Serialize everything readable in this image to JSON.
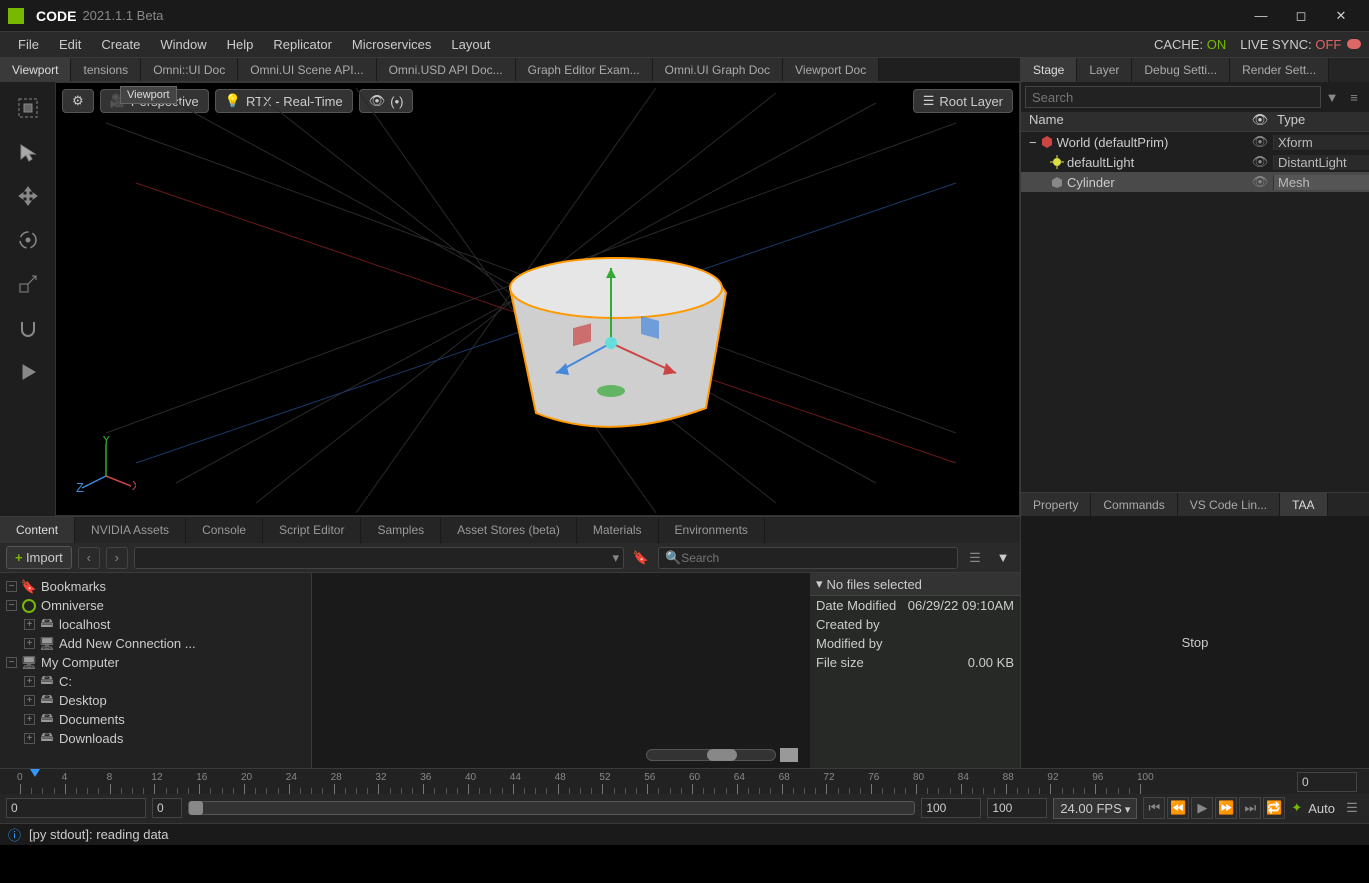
{
  "title": {
    "app": "CODE",
    "version": "2021.1.1 Beta"
  },
  "menu": [
    "File",
    "Edit",
    "Create",
    "Window",
    "Help",
    "Replicator",
    "Microservices",
    "Layout"
  ],
  "status_right": {
    "cache_label": "CACHE:",
    "cache_value": "ON",
    "livesync_label": "LIVE SYNC:",
    "livesync_value": "OFF"
  },
  "viewport_tabs": [
    "Viewport",
    "tensions",
    "Omni::UI Doc",
    "Omni.UI Scene API...",
    "Omni.USD API Doc...",
    "Graph Editor Exam...",
    "Omni.UI Graph Doc",
    "Viewport Doc"
  ],
  "viewport_tooltip": "Viewport",
  "vp_buttons": {
    "persp": "Perspective",
    "render": "RTX - Real-Time",
    "rootlayer": "Root Layer"
  },
  "axis": {
    "x": "X",
    "y": "Y",
    "z": "Z"
  },
  "stage_tabs": [
    "Stage",
    "Layer",
    "Debug Setti...",
    "Render Sett..."
  ],
  "stage_search_placeholder": "Search",
  "stage_headers": {
    "name": "Name",
    "type": "Type"
  },
  "stage_rows": [
    {
      "indent": 0,
      "name": "World (defaultPrim)",
      "type": "Xform",
      "icon": "world",
      "selected": false,
      "exp": "−"
    },
    {
      "indent": 1,
      "name": "defaultLight",
      "type": "DistantLight",
      "icon": "light",
      "selected": false,
      "exp": ""
    },
    {
      "indent": 1,
      "name": "Cylinder",
      "type": "Mesh",
      "icon": "mesh",
      "selected": true,
      "exp": ""
    }
  ],
  "prop_tabs": [
    "Property",
    "Commands",
    "VS Code Lin...",
    "TAA"
  ],
  "prop_stop": "Stop",
  "content_tabs": [
    "Content",
    "NVIDIA Assets",
    "Console",
    "Script Editor",
    "Samples",
    "Asset Stores (beta)",
    "Materials",
    "Environments"
  ],
  "content_import": "Import",
  "content_search_placeholder": "Search",
  "content_tree": [
    {
      "indent": 0,
      "exp": "−",
      "icon": "bookmark",
      "label": "Bookmarks"
    },
    {
      "indent": 0,
      "exp": "−",
      "icon": "omni",
      "label": "Omniverse"
    },
    {
      "indent": 1,
      "exp": "+",
      "icon": "drive",
      "label": "localhost"
    },
    {
      "indent": 1,
      "exp": "+",
      "icon": "pc",
      "label": "Add New Connection ..."
    },
    {
      "indent": 0,
      "exp": "−",
      "icon": "pc",
      "label": "My Computer"
    },
    {
      "indent": 1,
      "exp": "+",
      "icon": "drive",
      "label": "C:"
    },
    {
      "indent": 1,
      "exp": "+",
      "icon": "drive",
      "label": "Desktop"
    },
    {
      "indent": 1,
      "exp": "+",
      "icon": "drive",
      "label": "Documents"
    },
    {
      "indent": 1,
      "exp": "+",
      "icon": "drive",
      "label": "Downloads"
    }
  ],
  "fileinfo": {
    "header": "No files selected",
    "rows": [
      {
        "k": "Date Modified",
        "v": "06/29/22 09:10AM"
      },
      {
        "k": "Created by",
        "v": ""
      },
      {
        "k": "Modified by",
        "v": ""
      },
      {
        "k": "File size",
        "v": "0.00 KB"
      }
    ]
  },
  "timeline": {
    "frame": "0",
    "start": "0",
    "in": "0",
    "out": "100",
    "end": "100",
    "fps": "24.00 FPS",
    "auto": "Auto",
    "ticks": [
      0,
      4,
      8,
      12,
      16,
      20,
      24,
      28,
      32,
      36,
      40,
      44,
      48,
      52,
      56,
      60,
      64,
      68,
      72,
      76,
      80,
      84,
      88,
      92,
      96,
      100
    ]
  },
  "statusbar": {
    "source": "[py stdout]:",
    "msg": "reading data"
  }
}
